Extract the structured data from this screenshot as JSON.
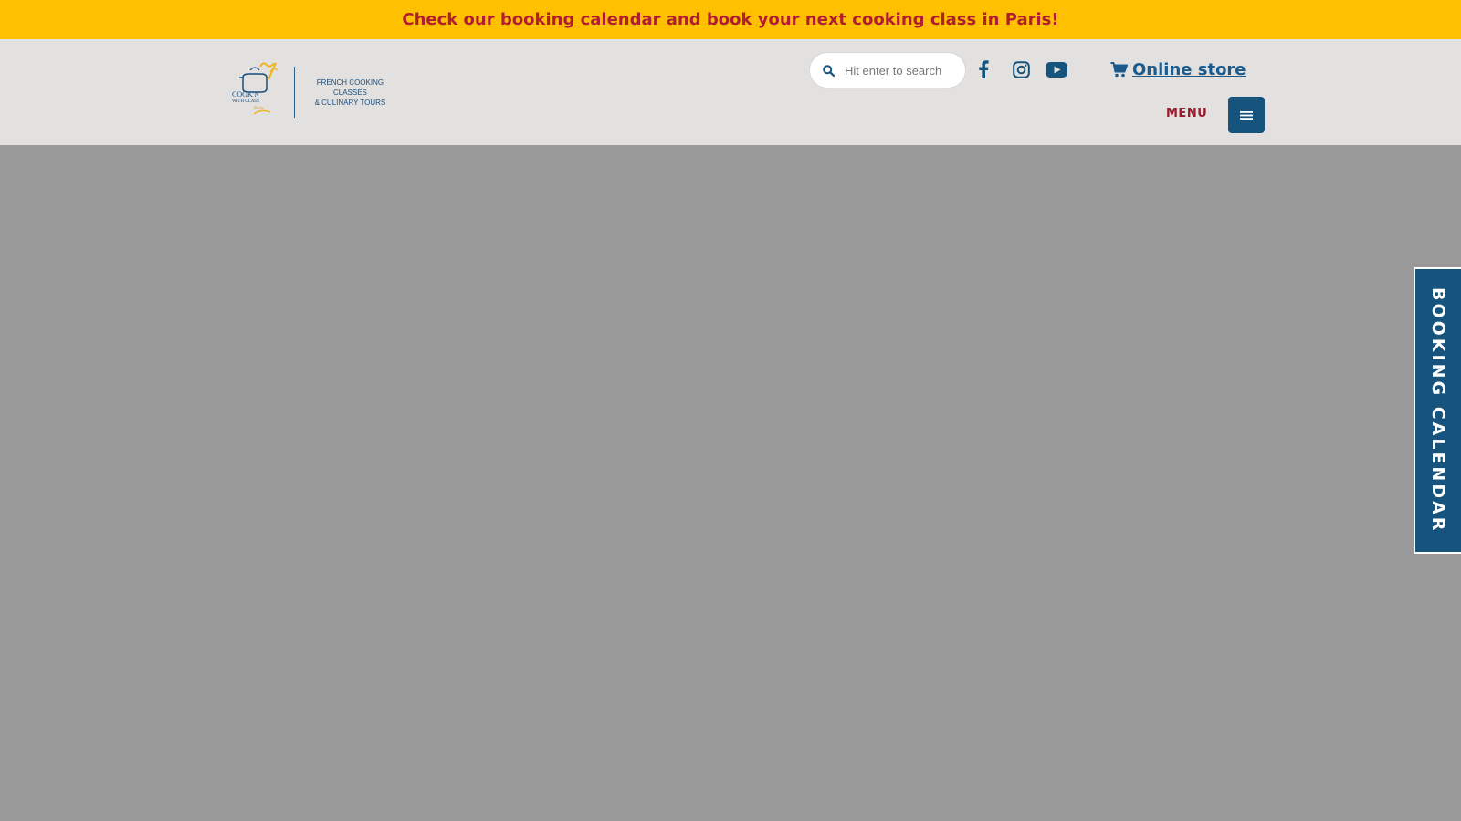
{
  "announcement": {
    "text": "Check our booking calendar and book your next cooking class in Paris!"
  },
  "header": {
    "logo": {
      "brand_line1": "COOK'N",
      "brand_line2": "WITH CLASS",
      "brand_line3": "Paris",
      "tagline_line1": "FRENCH COOKING CLASSES",
      "tagline_line2": "& CULINARY TOURS"
    },
    "search": {
      "placeholder": "Hit enter to search",
      "value": ""
    },
    "social": {
      "facebook_icon": "facebook-icon",
      "instagram_icon": "instagram-icon",
      "youtube_icon": "youtube-icon"
    },
    "online_store": {
      "label": "Online store",
      "icon": "cart-icon"
    },
    "menu": {
      "label": "MENU",
      "icon": "hamburger-icon"
    }
  },
  "booking_tab": {
    "label": "BOOKING CALENDAR"
  },
  "colors": {
    "announcement_bg": "#ffc000",
    "announcement_text": "#b01e2f",
    "header_bg": "#e3e1e0",
    "brand_blue": "#16547e",
    "link_blue": "#1a5a8c",
    "menu_red": "#9a1b2c",
    "overlay_gray": "#999999"
  }
}
